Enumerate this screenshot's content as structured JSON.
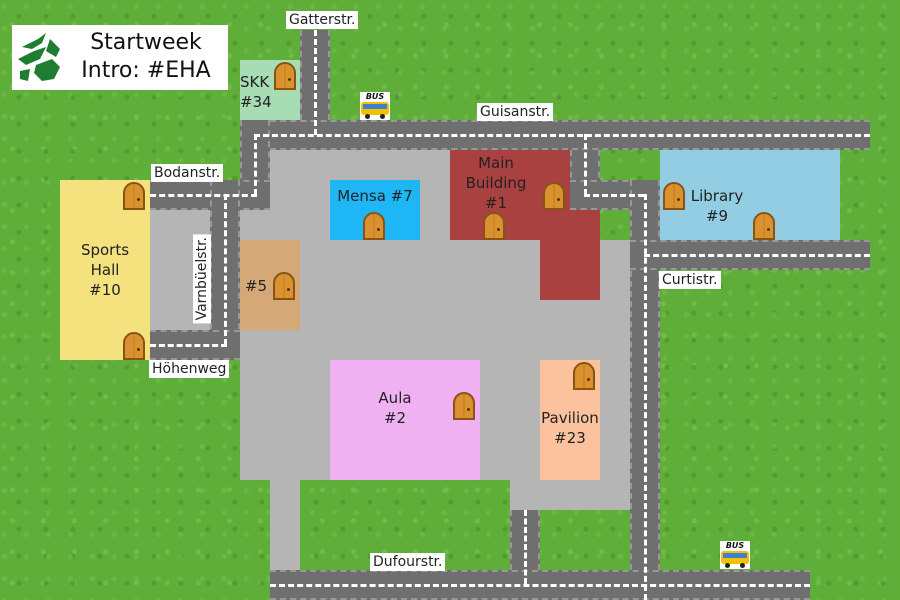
{
  "title": {
    "line1": "Startweek",
    "line2": "Intro: #EHA"
  },
  "colors": {
    "grass": "#5fae3a",
    "road": "#6f6f6f",
    "campus_area": "#b5b5b5",
    "skk": "#a8dcb4",
    "sports_hall": "#f3e27e",
    "mensa": "#1fb6f5",
    "main_building": "#a94141",
    "library": "#93cde3",
    "building5": "#d4a877",
    "aula": "#efb1f2",
    "pavilion": "#fcc29d",
    "logo": "#1e7d31"
  },
  "buildings": {
    "skk": {
      "line1": "SKK",
      "line2": "#34"
    },
    "sports_hall": {
      "line1": "Sports",
      "line2": "Hall",
      "line3": "#10"
    },
    "mensa": {
      "line1": "Mensa #7"
    },
    "main_building": {
      "line1": "Main",
      "line2": "Building",
      "line3": "#1"
    },
    "library": {
      "line1": "Library",
      "line2": "#9"
    },
    "building5": {
      "line1": "#5"
    },
    "aula": {
      "line1": "Aula",
      "line2": "#2"
    },
    "pavilion": {
      "line1": "Pavilion",
      "line2": "#23"
    }
  },
  "streets": {
    "gatterstr": "Gatterstr.",
    "guisanstr": "Guisanstr.",
    "bodanstr": "Bodanstr.",
    "varnbuelstr": "Varnbüelstr.",
    "hoehenweg": "Höhenweg",
    "curtistr": "Curtistr.",
    "dufourstr": "Dufourstr."
  },
  "bus_stops": {
    "label": "BUS"
  },
  "icons": {
    "door": "door-icon",
    "bus": "bus-icon",
    "logo": "university-logo-icon"
  }
}
